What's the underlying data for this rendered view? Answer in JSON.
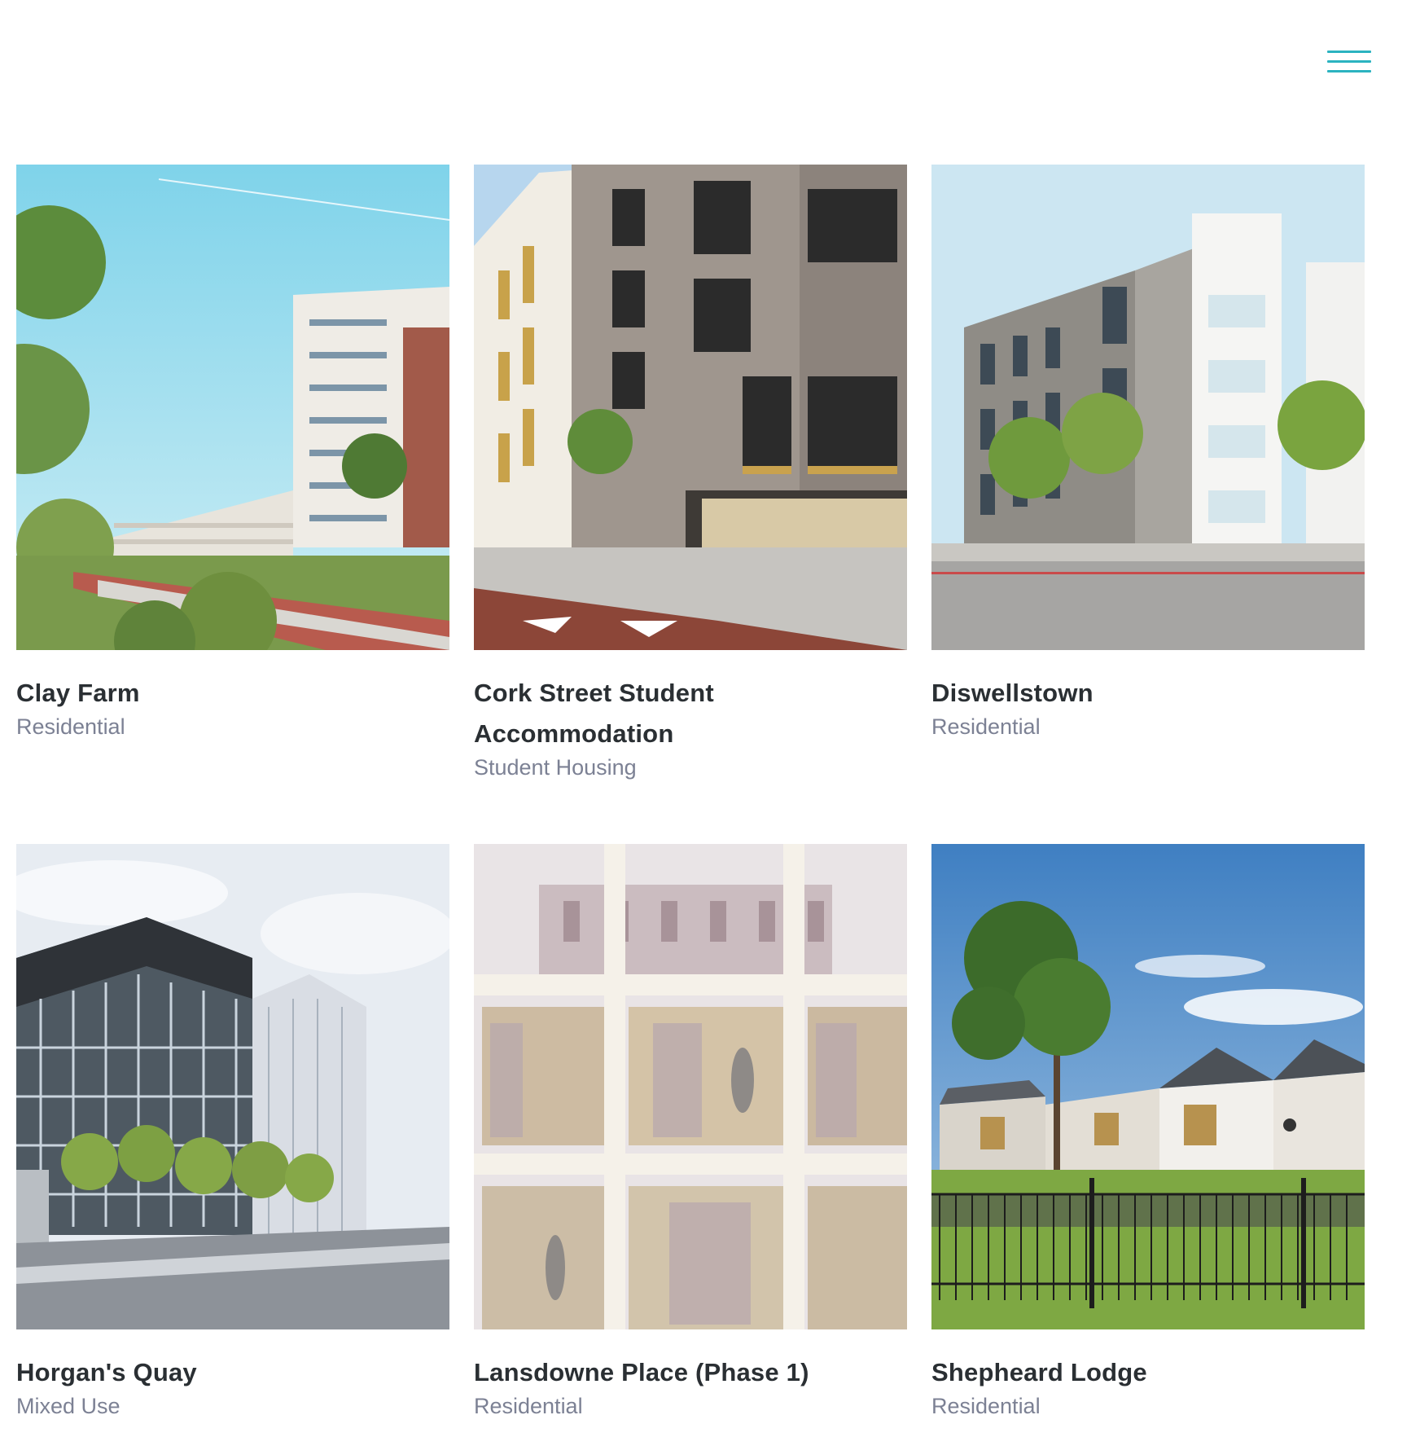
{
  "header": {
    "menu_icon": "hamburger-menu-icon",
    "accent_color": "#2bb3c0"
  },
  "projects": [
    {
      "title": "Clay Farm",
      "category": "Residential"
    },
    {
      "title": "Cork Street Student Accommodation",
      "category": "Student Housing"
    },
    {
      "title": "Diswellstown",
      "category": "Residential"
    },
    {
      "title": "Horgan's Quay",
      "category": "Mixed Use"
    },
    {
      "title": "Lansdowne Place (Phase 1)",
      "category": "Residential"
    },
    {
      "title": "Shepheard Lodge",
      "category": "Residential"
    }
  ],
  "colors": {
    "title_text": "#2a2f33",
    "category_text": "#7c8194"
  }
}
